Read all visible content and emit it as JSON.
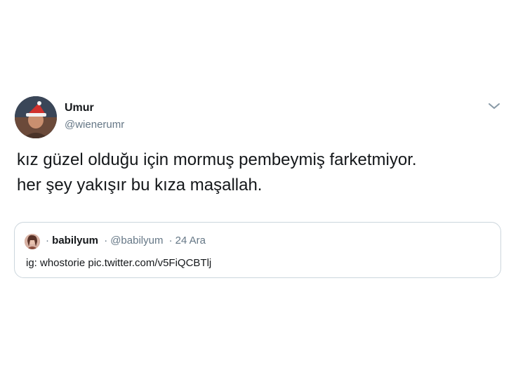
{
  "tweet": {
    "author": {
      "name": "Umur",
      "handle": "@wienerumr",
      "avatar_icon": "user-avatar-santa-hat"
    },
    "menu_icon": "chevron-down-icon",
    "text_lines": [
      "kız güzel olduğu için mormuş pembeymiş farketmiyor.",
      "her şey yakışır bu kıza maşallah."
    ]
  },
  "quoted_tweet": {
    "avatar_icon": "user-avatar",
    "prefix": "·",
    "name": "babilyum",
    "separator": "·",
    "handle": "@babilyum",
    "date_separator": "·",
    "date": "24 Ara",
    "text": "ig: whostorie pic.twitter.com/v5FiQCBTlj"
  },
  "colors": {
    "text_primary": "#14171a",
    "text_secondary": "#657786",
    "border": "#ccd6dd",
    "background": "#ffffff"
  }
}
